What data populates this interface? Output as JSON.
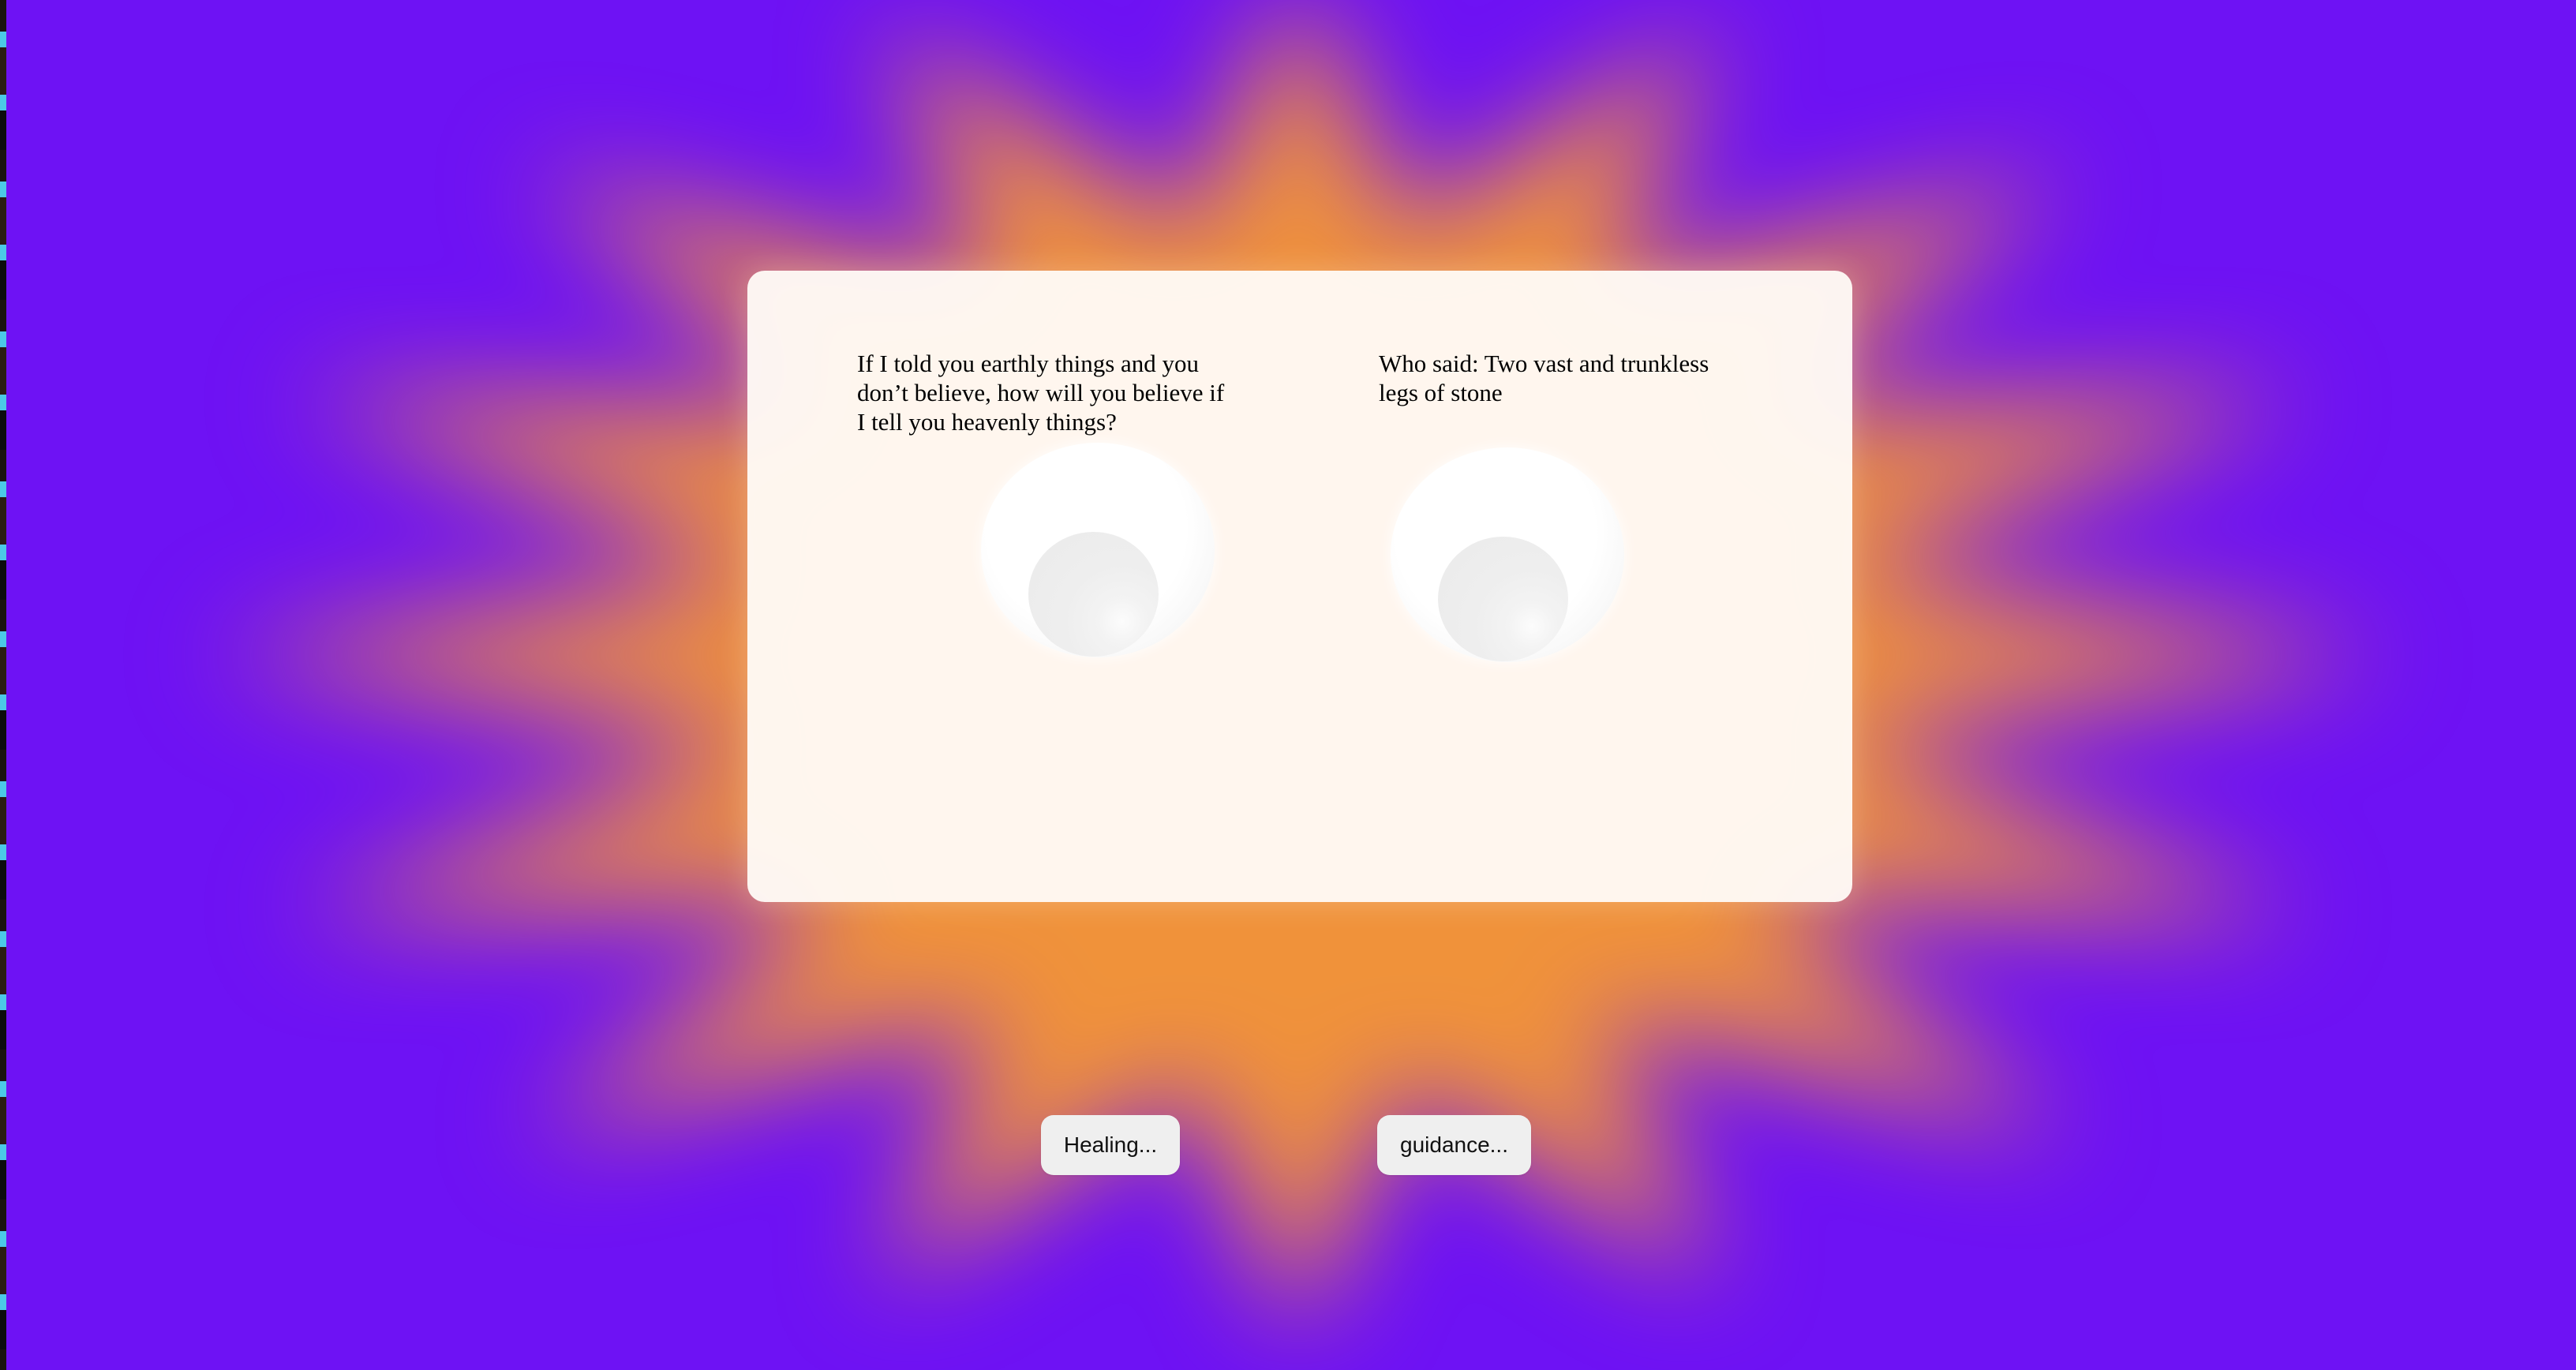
{
  "colors": {
    "background": "#6e12f4",
    "burst": "#f0923a",
    "card": "#fffcf8",
    "button": "#efefef"
  },
  "card": {
    "left_quote": "If I told you earthly things and you don’t believe, how will you believe if I tell you heavenly things?",
    "right_quote": "Who said: Two vast and trunkless legs of stone"
  },
  "buttons": {
    "left_label": "Healing...",
    "right_label": "guidance..."
  },
  "icons": {
    "left_eye": "googly-eye-icon",
    "right_eye": "googly-eye-icon"
  }
}
